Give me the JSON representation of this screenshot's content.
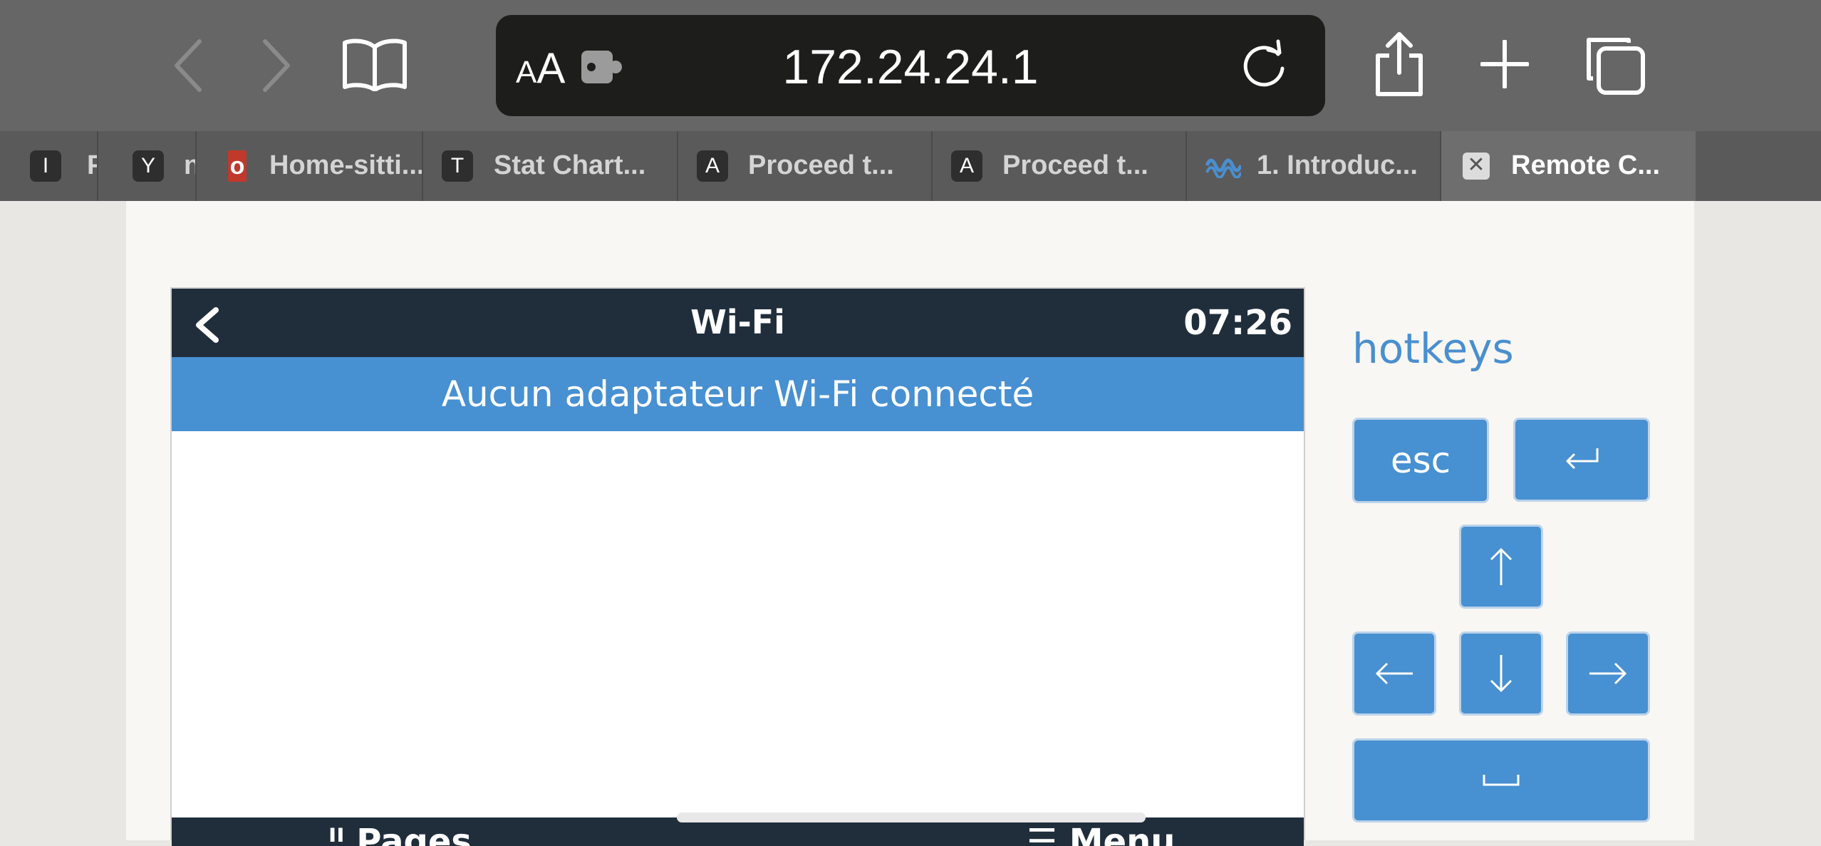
{
  "browser": {
    "url": "172.24.24.1",
    "aa_small": "A",
    "aa_big": "A",
    "tabs": [
      {
        "icon_letter": "I",
        "label": "P"
      },
      {
        "icon_letter": "Y",
        "label": "n"
      },
      {
        "icon_letter": "o",
        "label": "Home-sitti..."
      },
      {
        "icon_letter": "T",
        "label": "Stat Chart..."
      },
      {
        "icon_letter": "A",
        "label": "Proceed t..."
      },
      {
        "icon_letter": "A",
        "label": "Proceed t..."
      },
      {
        "icon_letter": "",
        "label": "1. Introduc..."
      },
      {
        "icon_letter": "✕",
        "label": "Remote C..."
      }
    ]
  },
  "device_screen": {
    "title": "Wi-Fi",
    "clock": "07:26",
    "notice": "Aucun adaptateur Wi-Fi connecté",
    "footer_left": "ᴵᴵ Pages",
    "footer_right": "☰ Menu"
  },
  "hotkeys": {
    "title": "hotkeys",
    "esc_label": "esc"
  },
  "colors": {
    "toolbar": "#666666",
    "tabbar": "#5a5a5a",
    "accent_blue": "#4790d2",
    "screen_header": "#202e3c"
  }
}
